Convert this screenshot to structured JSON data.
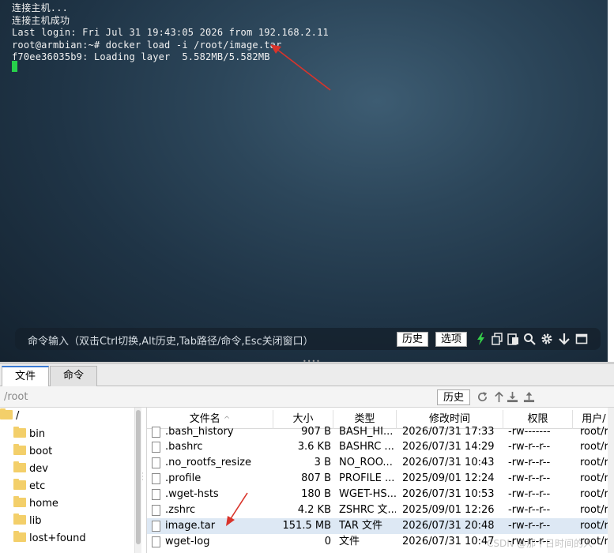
{
  "terminal": {
    "lines": [
      "连接主机...",
      "连接主机成功",
      "Last login: Fri Jul 31 19:43:05 2026 from 192.168.2.11",
      "root@armbian:~# docker load -i /root/image.tar",
      "f70ee36035b9: Loading layer  5.582MB/5.582MB"
    ],
    "cursor_color": "#27d14b"
  },
  "command_bar": {
    "hint": "命令输入（双击Ctrl切换,Alt历史,Tab路径/命令,Esc关闭窗口）",
    "history_button": "历史",
    "options_button": "选项",
    "tools": [
      "lightning-icon",
      "copy-icon",
      "paste-icon",
      "search-icon",
      "gear-icon",
      "down-arrow-icon",
      "window-icon"
    ]
  },
  "tabs": [
    {
      "label": "文件",
      "active": true
    },
    {
      "label": "命令",
      "active": false
    }
  ],
  "path": {
    "value": "/root",
    "history_button": "历史",
    "icons": [
      "refresh-icon",
      "up-icon",
      "download-icon",
      "upload-icon"
    ]
  },
  "tree": {
    "root": "/",
    "items": [
      "bin",
      "boot",
      "dev",
      "etc",
      "home",
      "lib",
      "lost+found"
    ]
  },
  "file_list": {
    "columns": {
      "name": "文件名",
      "size": "大小",
      "type": "类型",
      "mtime": "修改时间",
      "perm": "权限",
      "user": "用户/"
    },
    "rows": [
      {
        "name": ".bash_history",
        "size": "907 B",
        "type": "BASH_HI...",
        "mtime": "2026/07/31 17:33",
        "perm": "-rw-------",
        "user": "root/r",
        "selected": false
      },
      {
        "name": ".bashrc",
        "size": "3.6 KB",
        "type": "BASHRC ...",
        "mtime": "2026/07/31 14:29",
        "perm": "-rw-r--r--",
        "user": "root/r",
        "selected": false
      },
      {
        "name": ".no_rootfs_resize",
        "size": "3 B",
        "type": "NO_ROO...",
        "mtime": "2026/07/31 10:43",
        "perm": "-rw-r--r--",
        "user": "root/r",
        "selected": false
      },
      {
        "name": ".profile",
        "size": "807 B",
        "type": "PROFILE ...",
        "mtime": "2025/09/01 12:24",
        "perm": "-rw-r--r--",
        "user": "root/r",
        "selected": false
      },
      {
        "name": ".wget-hsts",
        "size": "180 B",
        "type": "WGET-HS...",
        "mtime": "2026/07/31 10:53",
        "perm": "-rw-r--r--",
        "user": "root/r",
        "selected": false
      },
      {
        "name": ".zshrc",
        "size": "4.2 KB",
        "type": "ZSHRC 文...",
        "mtime": "2025/09/01 12:26",
        "perm": "-rw-r--r--",
        "user": "root/r",
        "selected": false
      },
      {
        "name": "image.tar",
        "size": "151.5 MB",
        "type": "TAR 文件",
        "mtime": "2026/07/31 20:48",
        "perm": "-rw-r--r--",
        "user": "root/r",
        "selected": true
      },
      {
        "name": "wget-log",
        "size": "0",
        "type": "文件",
        "mtime": "2026/07/31 10:47",
        "perm": "-rw-r--r--",
        "user": "root/r",
        "selected": false
      }
    ]
  },
  "watermark": "CSDN @那个日时间的人",
  "colors": {
    "annotation_arrow": "#d9342b",
    "selected_row": "#dde8f4",
    "active_tab_border": "#3a7bd5"
  }
}
